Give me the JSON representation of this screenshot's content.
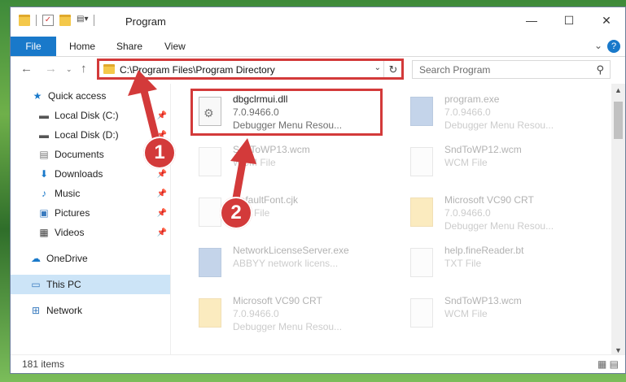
{
  "window": {
    "title": "Program",
    "ribbon_tabs": [
      "File",
      "Home",
      "Share",
      "View"
    ],
    "help": "?"
  },
  "nav": {
    "address": "C:\\Program Files\\Program Directory",
    "search_placeholder": "Search Program"
  },
  "sidebar": {
    "items": [
      {
        "label": "Quick access",
        "icon": "star-icon"
      },
      {
        "label": "Local Disk (C:)",
        "icon": "drive-icon"
      },
      {
        "label": "Local Disk (D:)",
        "icon": "drive-icon"
      },
      {
        "label": "Documents",
        "icon": "documents-icon"
      },
      {
        "label": "Downloads",
        "icon": "downloads-icon"
      },
      {
        "label": "Music",
        "icon": "music-icon"
      },
      {
        "label": "Pictures",
        "icon": "pictures-icon"
      },
      {
        "label": "Videos",
        "icon": "videos-icon"
      },
      {
        "label": "OneDrive",
        "icon": "cloud-icon"
      },
      {
        "label": "This PC",
        "icon": "computer-icon"
      },
      {
        "label": "Network",
        "icon": "network-icon"
      }
    ]
  },
  "files": [
    {
      "name": "dbgclrmui.dll",
      "line1": "7.0.9466.0",
      "line2": "Debugger Menu Resou..."
    },
    {
      "name": "program.exe",
      "line1": "7.0.9466.0",
      "line2": "Debugger Menu Resou..."
    },
    {
      "name": "SndToWP13.wcm",
      "line1": "WCM File",
      "line2": ""
    },
    {
      "name": "SndToWP12.wcm",
      "line1": "WCM File",
      "line2": ""
    },
    {
      "name": "DefaultFont.cjk",
      "line1": "CJK File",
      "line2": ""
    },
    {
      "name": "Microsoft VC90 CRT",
      "line1": "7.0.9466.0",
      "line2": "Debugger Menu Resou..."
    },
    {
      "name": "NetworkLicenseServer.exe",
      "line1": "ABBYY network licens...",
      "line2": ""
    },
    {
      "name": "help.fineReader.bt",
      "line1": "TXT File",
      "line2": ""
    },
    {
      "name": "Microsoft VC90 CRT",
      "line1": "7.0.9466.0",
      "line2": "Debugger Menu Resou..."
    },
    {
      "name": "SndToWP13.wcm",
      "line1": "WCM File",
      "line2": ""
    }
  ],
  "status": {
    "count": "181 items"
  },
  "annotations": {
    "step1": "1",
    "step2": "2"
  },
  "colors": {
    "accent": "#1979ca",
    "highlight": "#d33a3a"
  }
}
